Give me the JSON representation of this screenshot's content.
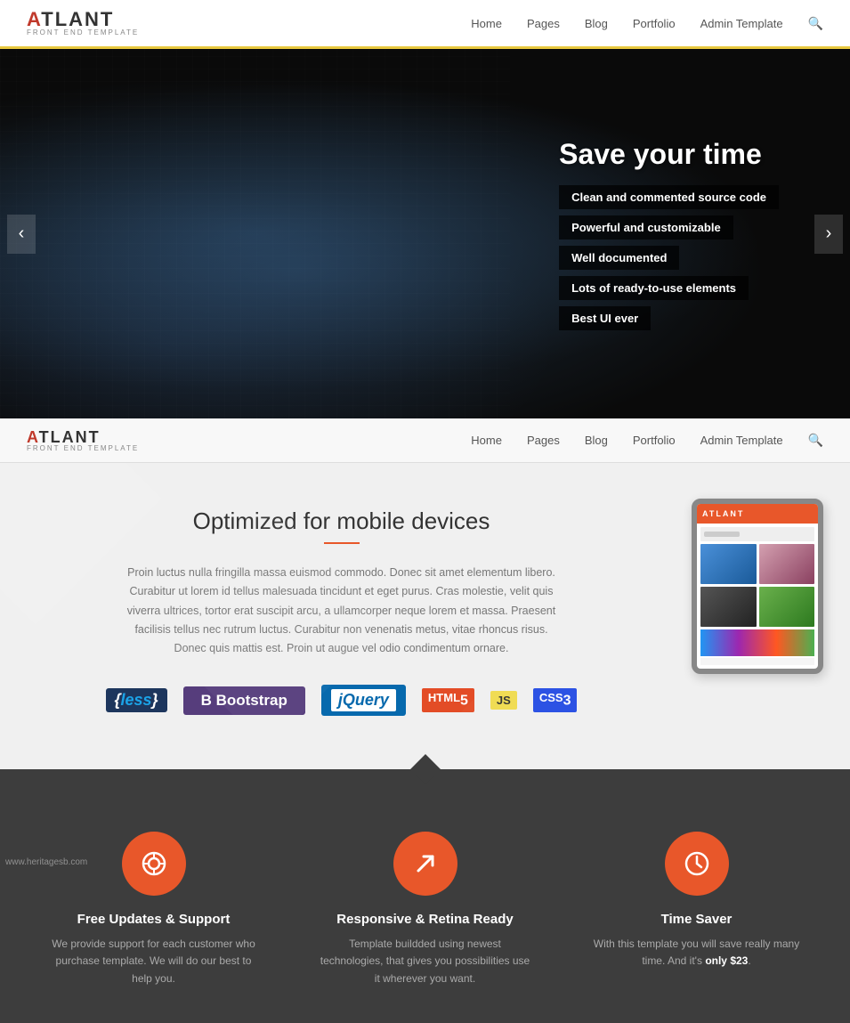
{
  "brand": {
    "name_prefix": "A",
    "name_rest": "TLANT",
    "tagline": "FRONT END TEMPLATE"
  },
  "nav": {
    "links": [
      "Home",
      "Pages",
      "Blog",
      "Portfolio",
      "Admin Template"
    ]
  },
  "hero": {
    "title": "Save your time",
    "features": [
      "Clean and commented source code",
      "Powerful and customizable",
      "Well documented",
      "Lots of ready-to-use elements",
      "Best UI ever"
    ],
    "prev_label": "‹",
    "next_label": "›"
  },
  "mobile_section": {
    "title": "Optimized for mobile devices",
    "description": "Proin luctus nulla fringilla massa euismod commodo. Donec sit amet elementum libero. Curabitur ut lorem id tellus malesuada tincidunt et eget purus. Cras molestie, velit quis viverra ultrices, tortor erat suscipit arcu, a ullamcorper neque lorem et massa. Praesent facilisis tellus nec rutrum luctus. Curabitur non venenatis metus, vitae rhoncus risus. Donec quis mattis est. Proin ut augue vel odio condimentum ornare.",
    "tech_badges": [
      {
        "label": "less",
        "type": "less"
      },
      {
        "label": "B Bootstrap",
        "type": "bootstrap"
      },
      {
        "label": "jQuery",
        "type": "jquery"
      },
      {
        "label": "HTML5",
        "type": "html5"
      },
      {
        "label": "JS",
        "type": "js"
      },
      {
        "label": "CSS3",
        "type": "css3"
      }
    ]
  },
  "feature_cards": [
    {
      "icon": "⊙",
      "title": "Free Updates & Support",
      "description": "We provide support for each customer who purchase template. We will do our best to help you."
    },
    {
      "icon": "↗",
      "title": "Responsive & Retina Ready",
      "description": "Template buildded using newest technologies, that gives you possibilities use it wherever you want."
    },
    {
      "icon": "◷",
      "title": "Time Saver",
      "description": "With this template you will save really many time. And it's only $23.",
      "highlight": "$23"
    }
  ],
  "watermark": "www.heritagesb.com"
}
